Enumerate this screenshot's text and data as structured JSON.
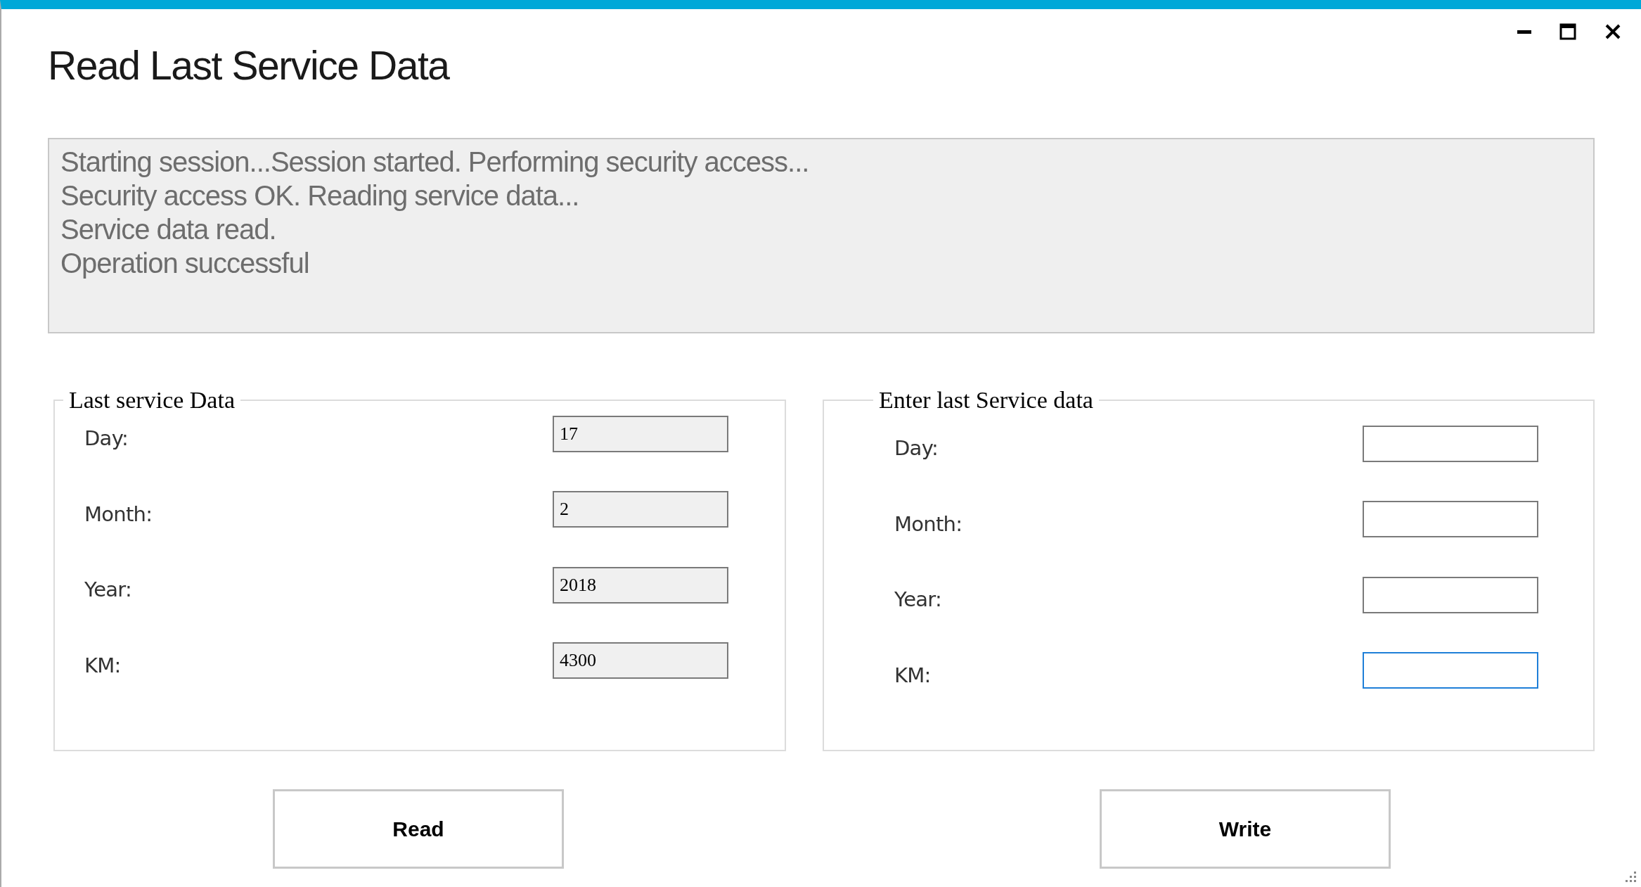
{
  "window": {
    "title": "Read Last Service Data"
  },
  "log": {
    "lines": [
      "Starting session...Session started. Performing security access...",
      "Security access OK. Reading service data...",
      "Service data read.",
      "Operation successful"
    ]
  },
  "groups": [
    {
      "title": "Last service Data",
      "readonly": true,
      "fields": [
        {
          "label": "Day:",
          "value": "17",
          "focused": false
        },
        {
          "label": "Month:",
          "value": "2",
          "focused": false
        },
        {
          "label": "Year:",
          "value": "2018",
          "focused": false
        },
        {
          "label": "KM:",
          "value": "4300",
          "focused": false
        }
      ]
    },
    {
      "title": "Enter last Service data",
      "readonly": false,
      "fields": [
        {
          "label": "Day:",
          "focused": false
        },
        {
          "label": "Month:",
          "focused": false
        },
        {
          "label": "Year:",
          "focused": false
        },
        {
          "label": "KM:",
          "focused": true
        }
      ]
    }
  ],
  "buttons": [
    {
      "label": "Read"
    },
    {
      "label": "Write"
    }
  ]
}
